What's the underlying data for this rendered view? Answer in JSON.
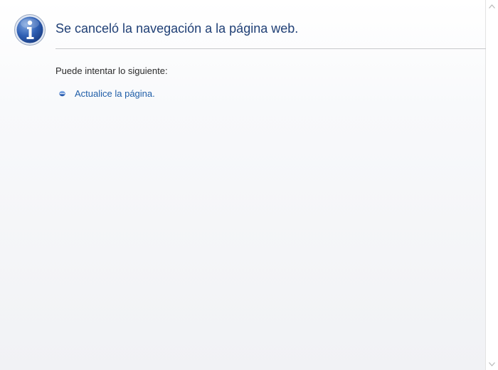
{
  "main": {
    "title": "Se canceló la navegación a la página web.",
    "suggestions_label": "Puede intentar lo siguiente:",
    "suggestions": [
      {
        "label": "Actualice la página."
      }
    ]
  },
  "icons": {
    "header": "info-icon",
    "bullet": "bullet-icon",
    "scroll_up": "chevron-up-icon",
    "scroll_down": "chevron-down-icon"
  },
  "colors": {
    "title": "#1f3f75",
    "link": "#1f5ea8",
    "icon_blue": "#2a5caa",
    "divider": "#c7c9cc"
  }
}
